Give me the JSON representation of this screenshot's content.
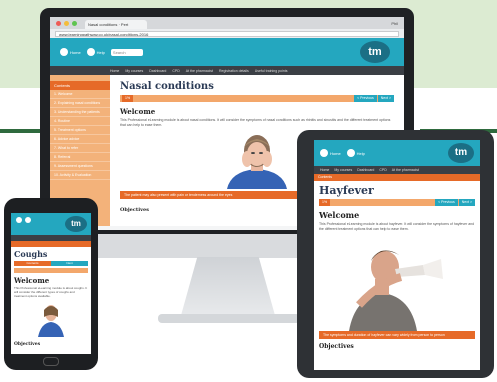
{
  "colors": {
    "teal": "#24a7bf",
    "orange": "#e66a28",
    "peach": "#f3b27a",
    "navy": "#2a3a55",
    "green_band": "#dcebd2"
  },
  "monitor": {
    "browser_tab": "Nasal conditions · Pert",
    "browser_user": "Phil",
    "url": "www.learningpathway.co.uk/nasal-conditions-2016",
    "header_links": [
      "Home",
      "Help"
    ],
    "search_placeholder": "Search",
    "logo": "tm",
    "nav_items": [
      "Home",
      "My courses",
      "Dashboard",
      "CPD",
      "At the pharmacist",
      "Registration details",
      "Useful training points"
    ],
    "sidebar_heading": "Contents",
    "sidebar_items": [
      "1. Welcome",
      "2. Explaining nasal conditions",
      "3. Understanding the patients",
      "4. Routine",
      "5. Treatment options",
      "6. Advice advice",
      "7. What to refer",
      "8. Referral",
      "9. Assessment questions",
      "10. Activity & Evaluation"
    ],
    "page_title": "Nasal conditions",
    "progress_label": "1%",
    "prev_label": "< Previous",
    "next_label": "Next >",
    "welcome": "Welcome",
    "intro": "This Professional eLearning module is about nasal conditions. It will consider the symptoms of nasal conditions such as rhinitis and sinusitis and the different treatment options that can help to ease them.",
    "caption": "The patient may also present with pain or tenderness around the eyes",
    "objectives": "Objectives"
  },
  "tablet": {
    "header_links": [
      "Home",
      "Help"
    ],
    "logo": "tm",
    "nav_items": [
      "Home",
      "My courses",
      "Dashboard",
      "CPD",
      "At the pharmacist"
    ],
    "crumb": "Contents",
    "page_title": "Hayfever",
    "progress_label": "1%",
    "prev_label": "< Previous",
    "next_label": "Next >",
    "welcome": "Welcome",
    "intro": "This Professional eLearning module is about hayfever. It will consider the symptoms of hayfever and the different treatment options that can help to ease them.",
    "caption": "The symptoms and duration of hayfever can vary widely from person to person",
    "objectives": "Objectives"
  },
  "phone": {
    "logo": "tm",
    "page_title": "Coughs",
    "tab_prev": "Contents",
    "tab_next": "Next",
    "welcome": "Welcome",
    "intro": "This Professional eLearning module is about coughs. It will consider the different types of coughs and treatment options available.",
    "objectives": "Objectives"
  }
}
